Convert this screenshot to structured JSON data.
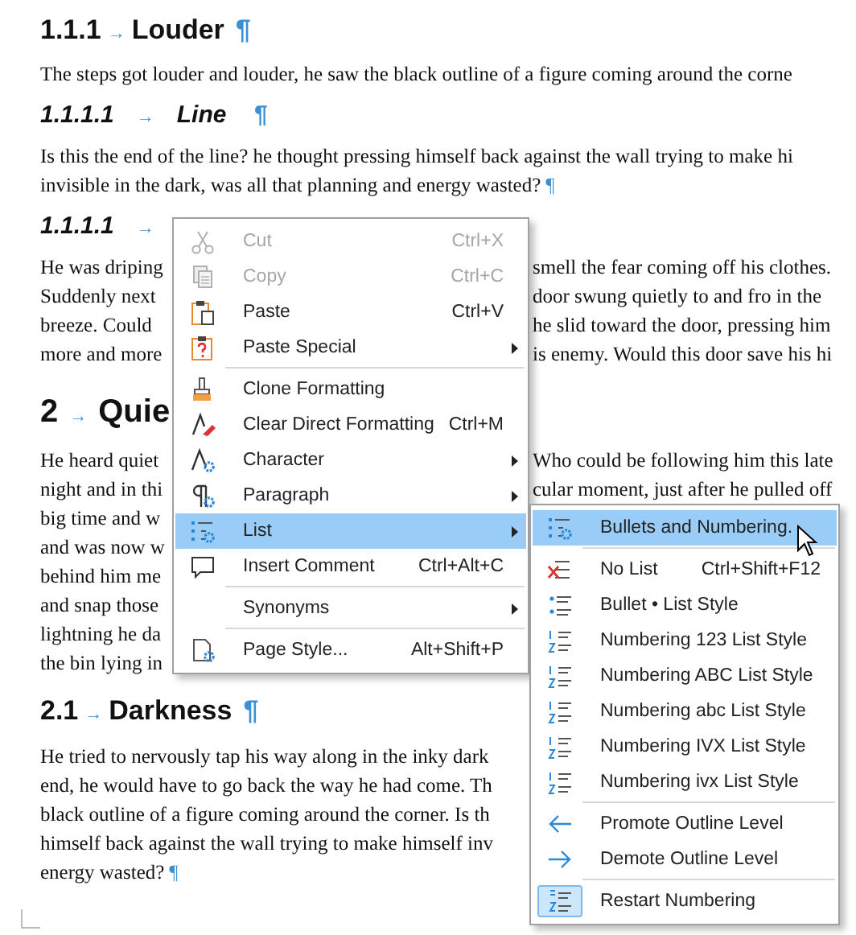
{
  "document": {
    "blocks": [
      {
        "kind": "heading3",
        "number": "1.1.1",
        "arrow": "→",
        "title": "Louder",
        "pilcrow": "¶"
      },
      {
        "kind": "line",
        "left": "The steps got louder and louder, he saw the black outline of a figure coming around the corne"
      },
      {
        "kind": "heading4",
        "number": "1.1.1.1",
        "arrow": "→",
        "title": "Line",
        "pilcrow": "¶"
      },
      {
        "kind": "line",
        "left": "Is this the end of the line? he thought pressing himself back against the wall trying to make hi"
      },
      {
        "kind": "line",
        "left": "invisible in the dark, was all that planning and energy wasted?",
        "pilcrow": "¶"
      },
      {
        "kind": "heading4",
        "number": "1.1.1.1",
        "arrow": "→"
      },
      {
        "kind": "line",
        "left": "He was driping",
        "right": "smell the fear coming off his clothes."
      },
      {
        "kind": "line",
        "left": "Suddenly next",
        "right": "door swung quietly to and fro in the"
      },
      {
        "kind": "line",
        "left": "breeze. Could",
        "right": "he slid toward the door, pressing him"
      },
      {
        "kind": "line",
        "left": "more and more",
        "right": "is enemy. Would this door save his hi"
      },
      {
        "kind": "heading1",
        "number": "2",
        "arrow": "→",
        "title": "Quie"
      },
      {
        "kind": "line",
        "left": "He heard quiet",
        "right": "Who could be following him this late"
      },
      {
        "kind": "line",
        "left": "night and in thi",
        "right": "cular moment, just after he pulled off"
      },
      {
        "kind": "line",
        "left": "big time and w"
      },
      {
        "kind": "line",
        "left": "and was now w"
      },
      {
        "kind": "line",
        "left": "behind him me"
      },
      {
        "kind": "line",
        "left": "and snap those"
      },
      {
        "kind": "line",
        "left": "lightning he da"
      },
      {
        "kind": "line",
        "left": "the bin lying in"
      },
      {
        "kind": "heading2",
        "number": "2.1",
        "arrow": "→",
        "title": "Darkness",
        "pilcrow": "¶"
      },
      {
        "kind": "line",
        "left": "He tried to nervously tap his way along in the inky dark"
      },
      {
        "kind": "line",
        "left": "end, he would have to go back the way he had come. Th"
      },
      {
        "kind": "line",
        "left": "black outline of a figure coming around the corner. Is th"
      },
      {
        "kind": "line",
        "left": "himself back against the wall trying to make himself inv"
      },
      {
        "kind": "line",
        "left": "energy wasted?",
        "pilcrow": "¶"
      }
    ]
  },
  "context_menu": {
    "groups": [
      [
        {
          "label": "Cut",
          "shortcut": "Ctrl+X",
          "submenu": false,
          "disabled": true,
          "selected": false
        },
        {
          "label": "Copy",
          "shortcut": "Ctrl+C",
          "submenu": false,
          "disabled": true,
          "selected": false
        },
        {
          "label": "Paste",
          "shortcut": "Ctrl+V",
          "submenu": false,
          "disabled": false,
          "selected": false
        },
        {
          "label": "Paste Special",
          "submenu": true,
          "disabled": false,
          "selected": false
        }
      ],
      [
        {
          "label": "Clone Formatting",
          "submenu": false,
          "disabled": false,
          "selected": false
        },
        {
          "label": "Clear Direct Formatting",
          "shortcut": "Ctrl+M",
          "submenu": false,
          "disabled": false,
          "selected": false
        },
        {
          "label": "Character",
          "submenu": true,
          "disabled": false,
          "selected": false
        },
        {
          "label": "Paragraph",
          "submenu": true,
          "disabled": false,
          "selected": false
        },
        {
          "label": "List",
          "submenu": true,
          "disabled": false,
          "selected": true
        },
        {
          "label": "Insert Comment",
          "shortcut": "Ctrl+Alt+C",
          "submenu": false,
          "disabled": false,
          "selected": false
        }
      ],
      [
        {
          "label": "Synonyms",
          "submenu": true,
          "disabled": false,
          "selected": false
        }
      ],
      [
        {
          "label": "Page Style...",
          "shortcut": "Alt+Shift+P",
          "submenu": false,
          "disabled": false,
          "selected": false
        }
      ]
    ]
  },
  "list_submenu": {
    "groups": [
      [
        {
          "label": "Bullets and Numbering.",
          "selected": true,
          "checked": false
        }
      ],
      [
        {
          "label": "No List",
          "shortcut": "Ctrl+Shift+F12",
          "selected": false,
          "checked": false
        },
        {
          "label": "Bullet • List Style",
          "selected": false,
          "checked": false
        },
        {
          "label": "Numbering 123 List Style",
          "selected": false,
          "checked": false
        },
        {
          "label": "Numbering ABC List Style",
          "selected": false,
          "checked": false
        },
        {
          "label": "Numbering abc List Style",
          "selected": false,
          "checked": false
        },
        {
          "label": "Numbering IVX List Style",
          "selected": false,
          "checked": false
        },
        {
          "label": "Numbering ivx List Style",
          "selected": false,
          "checked": false
        }
      ],
      [
        {
          "label": "Promote Outline Level",
          "selected": false,
          "checked": false
        },
        {
          "label": "Demote Outline Level",
          "selected": false,
          "checked": false
        }
      ],
      [
        {
          "label": "Restart Numbering",
          "selected": false,
          "checked": true
        }
      ]
    ]
  }
}
